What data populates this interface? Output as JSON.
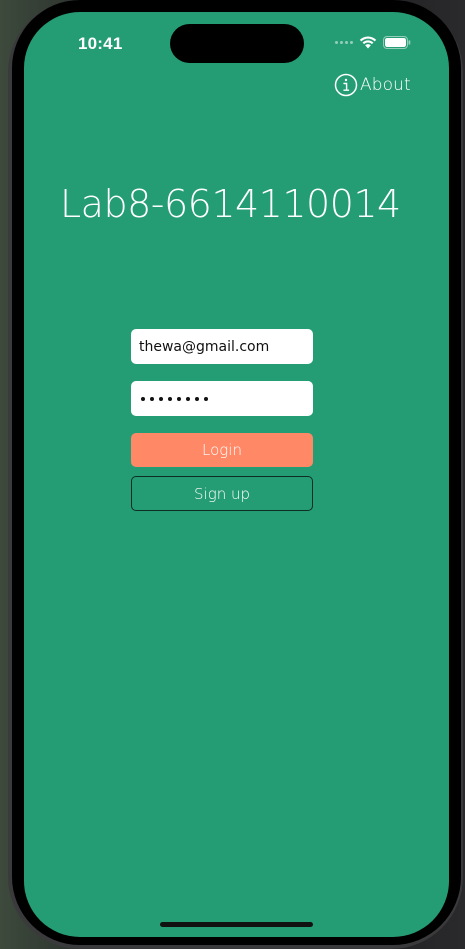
{
  "status_bar": {
    "time": "10:41",
    "icons": [
      "cellular-signal-icon",
      "wifi-icon",
      "battery-icon"
    ]
  },
  "nav": {
    "about_icon": "info-circle-icon",
    "about_label": "About"
  },
  "app": {
    "title": "Lab8-6614110014"
  },
  "form": {
    "email_value": "thewa@gmail.com",
    "password_masked_length": 8,
    "login_label": "Login",
    "signup_label": "Sign up"
  },
  "colors": {
    "background": "#259d74",
    "login_button": "#ff8866",
    "signup_border": "#0f2e22",
    "text": "#ffffff"
  }
}
